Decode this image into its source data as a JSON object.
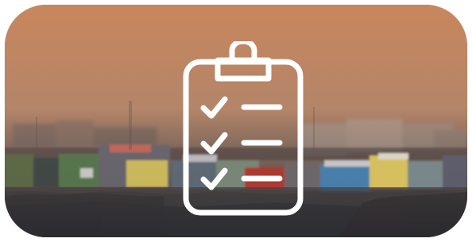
{
  "card": {
    "background_top": "#c8875e",
    "background_bottom": "#2a2c30"
  },
  "icon": {
    "name": "checklist-clipboard-icon",
    "stroke": "#ffffff",
    "rows": 3
  },
  "scene": {
    "house_colors": [
      "#5f6c47",
      "#c66b5d",
      "#d5c25f",
      "#4a84b5",
      "#e2cb62",
      "#5f6d7a",
      "#b53b31",
      "#d0d0d0"
    ]
  }
}
